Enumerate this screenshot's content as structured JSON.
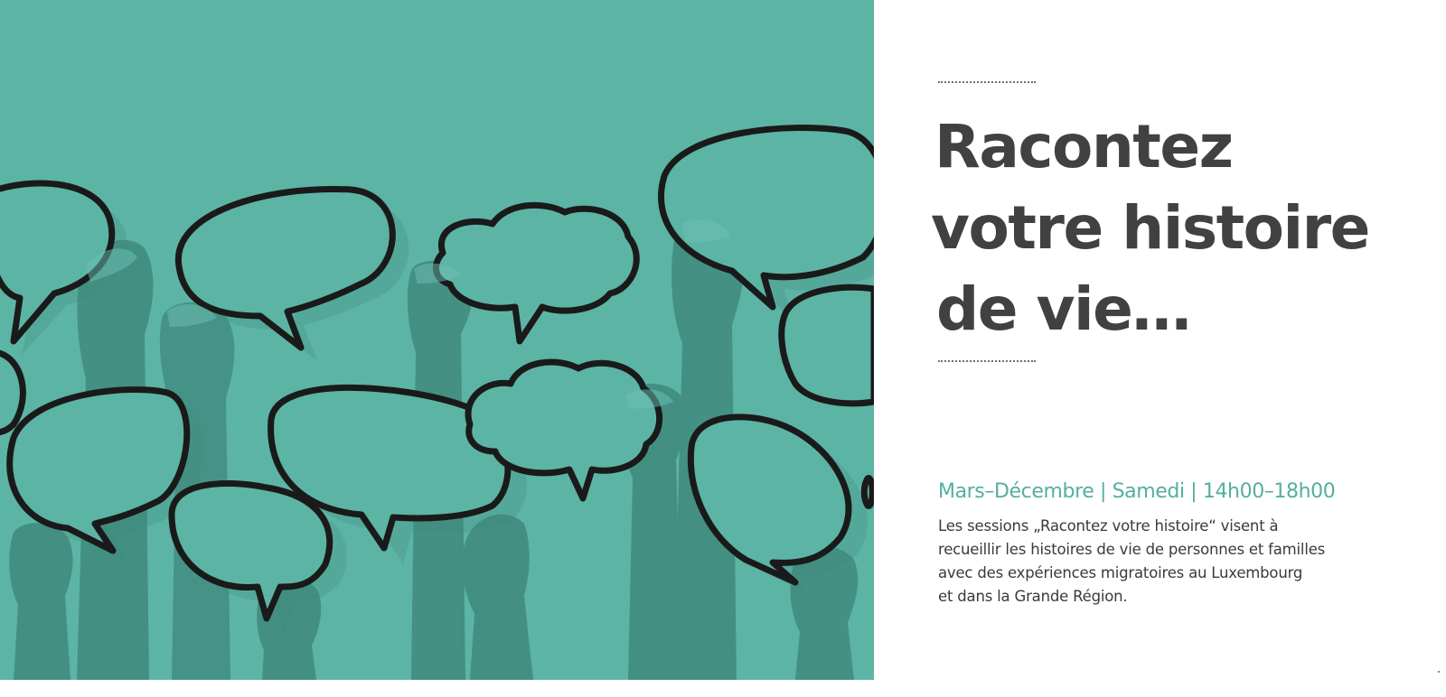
{
  "hero": {
    "background_color": "#5cb4a5",
    "image_subject": "hands-holding-speech-bubbles"
  },
  "headline": {
    "lines": [
      "Racontez",
      "votre histoire",
      "de vie…"
    ]
  },
  "schedule": {
    "text": "Mars–Décembre | Samedi | 14h00–18h00",
    "color": "#55ae9f"
  },
  "description": {
    "lines": [
      "Les sessions „Racontez votre histoire“ visent à",
      "recueillir les histoires de vie de personnes et familles",
      "avec des expériences migratoires au Luxembourg",
      "et dans la Grande Région."
    ]
  }
}
